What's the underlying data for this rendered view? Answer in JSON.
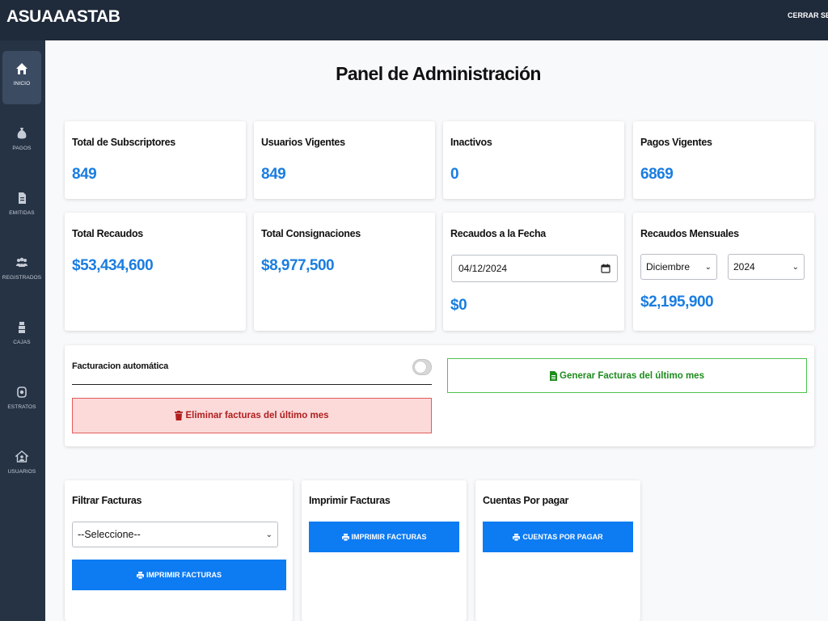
{
  "app": {
    "brand": "ASUAAASTAB",
    "logout_label": "CERRAR SESIÓN"
  },
  "sidebar": {
    "items": [
      {
        "label": "INICIO",
        "icon": "home-icon",
        "active": true
      },
      {
        "label": "PAGOS",
        "icon": "money-bag-icon",
        "active": false
      },
      {
        "label": "EMITIDAS",
        "icon": "document-icon",
        "active": false
      },
      {
        "label": "REGISTRADOS",
        "icon": "users-icon",
        "active": false
      },
      {
        "label": "CAJAS",
        "icon": "boxes-icon",
        "active": false
      },
      {
        "label": "ESTRATOS",
        "icon": "layers-icon",
        "active": false
      },
      {
        "label": "USUARIOS",
        "icon": "user-house-icon",
        "active": false
      }
    ]
  },
  "page": {
    "title": "Panel de Administración"
  },
  "stats": {
    "total_subscriptores": {
      "title": "Total de Subscriptores",
      "value": "849"
    },
    "usuarios_vigentes": {
      "title": "Usuarios Vigentes",
      "value": "849"
    },
    "inactivos": {
      "title": "Inactivos",
      "value": "0"
    },
    "pagos_vigentes": {
      "title": "Pagos Vigentes",
      "value": "6869"
    },
    "total_recaudos": {
      "title": "Total Recaudos",
      "value": "$53,434,600"
    },
    "total_consignaciones": {
      "title": "Total Consignaciones",
      "value": "$8,977,500"
    },
    "recaudos_fecha": {
      "title": "Recaudos a la Fecha",
      "date_value": "04/12/2024",
      "value": "$0"
    },
    "recaudos_mensuales": {
      "title": "Recaudos Mensuales",
      "month": "Diciembre",
      "year": "2024",
      "value": "$2,195,900"
    }
  },
  "facturacion": {
    "toggle_label": "Facturacion automática",
    "toggle_on": false,
    "delete_button": "Eliminar facturas del último mes",
    "generate_button": "Generar Facturas del último mes"
  },
  "filtrar": {
    "title": "Filtrar Facturas",
    "select_value": "--Seleccione--",
    "button": "IMPRIMIR FACTURAS"
  },
  "imprimir": {
    "title": "Imprimir Facturas",
    "button": "IMPRIMIR FACTURAS"
  },
  "cuentas": {
    "title": "Cuentas Por pagar",
    "button": "CUENTAS POR PAGAR"
  },
  "colors": {
    "accent": "#1a7de0",
    "primary_button": "#0d7bf2",
    "topbar": "#1f2a3a",
    "sidebar": "#263345",
    "danger": "#b01e1e",
    "success": "#1e8c1e"
  }
}
